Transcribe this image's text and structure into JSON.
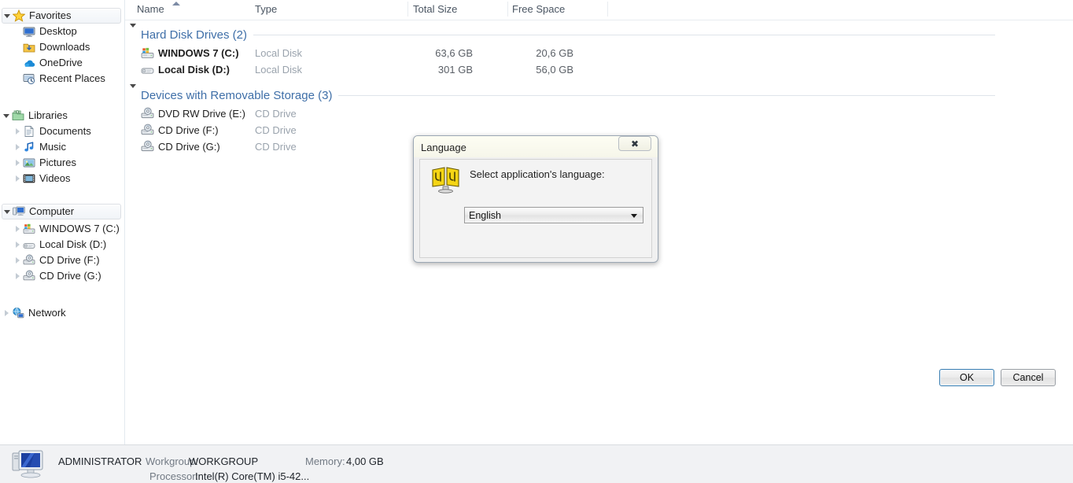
{
  "sidebar": {
    "groups": [
      {
        "name": "Favorites",
        "icon": "star-icon",
        "selected": true,
        "expander": "down",
        "items": [
          {
            "label": "Desktop",
            "icon": "desktop-icon",
            "expander": "none"
          },
          {
            "label": "Downloads",
            "icon": "downloads-folder-icon",
            "expander": "none"
          },
          {
            "label": "OneDrive",
            "icon": "onedrive-cloud-icon",
            "expander": "none"
          },
          {
            "label": "Recent Places",
            "icon": "recent-places-icon",
            "expander": "none"
          }
        ]
      },
      {
        "name": "Libraries",
        "icon": "libraries-folder-icon",
        "selected": false,
        "expander": "down",
        "items": [
          {
            "label": "Documents",
            "icon": "document-icon",
            "expander": "right"
          },
          {
            "label": "Music",
            "icon": "music-note-icon",
            "expander": "right"
          },
          {
            "label": "Pictures",
            "icon": "pictures-icon",
            "expander": "right"
          },
          {
            "label": "Videos",
            "icon": "video-film-icon",
            "expander": "right"
          }
        ]
      },
      {
        "name": "Computer",
        "icon": "computer-icon",
        "selected": true,
        "expander": "down",
        "items": [
          {
            "label": "WINDOWS 7 (C:)",
            "icon": "windows-drive-icon",
            "expander": "right"
          },
          {
            "label": "Local Disk (D:)",
            "icon": "hard-disk-icon",
            "expander": "right"
          },
          {
            "label": "CD Drive (F:)",
            "icon": "cd-drive-icon",
            "expander": "right"
          },
          {
            "label": "CD Drive (G:)",
            "icon": "cd-drive-icon",
            "expander": "right"
          }
        ]
      },
      {
        "name": "Network",
        "icon": "network-icon",
        "selected": false,
        "expander": "right",
        "items": []
      }
    ]
  },
  "filelist": {
    "columns": [
      {
        "label": "Name",
        "sorted": "asc"
      },
      {
        "label": "Type",
        "sorted": "none"
      },
      {
        "label": "Total Size",
        "sorted": "none"
      },
      {
        "label": "Free Space",
        "sorted": "none"
      }
    ],
    "groups": [
      {
        "title": "Hard Disk Drives (2)",
        "expander": "down",
        "rows": [
          {
            "name": "WINDOWS 7 (C:)",
            "icon": "windows-drive-icon",
            "type": "Local Disk",
            "total_size": "63,6 GB",
            "free_space": "20,6 GB"
          },
          {
            "name": "Local Disk (D:)",
            "icon": "hard-disk-icon",
            "type": "Local Disk",
            "total_size": "301 GB",
            "free_space": "56,0 GB"
          }
        ]
      },
      {
        "title": "Devices with Removable Storage (3)",
        "expander": "down",
        "rows": [
          {
            "name": "DVD RW Drive (E:)",
            "icon": "cd-drive-icon",
            "type": "CD Drive",
            "total_size": "",
            "free_space": ""
          },
          {
            "name": "CD Drive (F:)",
            "icon": "cd-drive-icon",
            "type": "CD Drive",
            "total_size": "",
            "free_space": ""
          },
          {
            "name": "CD Drive (G:)",
            "icon": "cd-drive-icon",
            "type": "CD Drive",
            "total_size": "",
            "free_space": ""
          }
        ]
      }
    ]
  },
  "statusbar": {
    "icon": "computer-monitor-icon",
    "computer_name": "ADMINISTRATOR",
    "workgroup_label": "Workgroup:",
    "workgroup_value": "WORKGROUP",
    "memory_label": "Memory:",
    "memory_value": "4,00 GB",
    "processor_label": "Processor:",
    "processor_value": "Intel(R) Core(TM) i5-42..."
  },
  "dialog": {
    "title": "Language",
    "close_glyph": "✖",
    "icon": "language-screens-icon",
    "prompt": "Select application's language:",
    "select": {
      "value": "English",
      "options": [
        "English"
      ]
    },
    "ok_label": "OK",
    "cancel_label": "Cancel"
  },
  "colors": {
    "group_title": "#3f6fa8",
    "dialog_face": "#f0f0f0",
    "focus_ring": "#3c7fb1",
    "muted_text": "#9aa3ad"
  }
}
